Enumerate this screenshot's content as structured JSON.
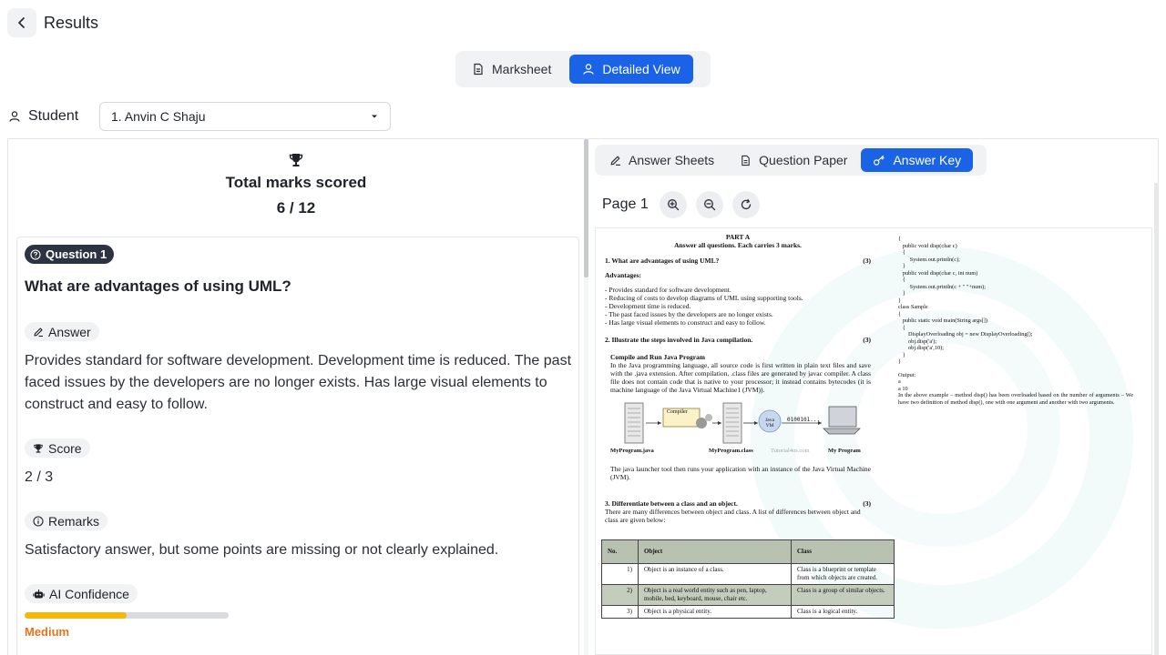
{
  "header": {
    "title": "Results"
  },
  "view_switch": {
    "items": [
      {
        "label": "Marksheet",
        "active": false
      },
      {
        "label": "Detailed View",
        "active": true
      }
    ]
  },
  "student": {
    "label": "Student",
    "selected": "1. Anvin C Shaju"
  },
  "summary": {
    "label": "Total marks scored",
    "value": "6 / 12"
  },
  "question": {
    "badge": "Question 1",
    "title": "What are advantages of using UML?",
    "answer_chip": "Answer",
    "answer_text": "Provides standard for software development. Development time is reduced. The past faced issues by the developers are no longer exists. Has large visual elements to construct and easy to follow.",
    "score_chip": "Score",
    "score_value": "2 / 3",
    "remarks_chip": "Remarks",
    "remarks_text": "Satisfactory answer, but some points are missing or not clearly explained.",
    "confidence_chip": "AI Confidence",
    "confidence_level": "Medium",
    "confidence_fraction": 0.5
  },
  "doc_tabs": [
    {
      "label": "Answer Sheets",
      "active": false
    },
    {
      "label": "Question Paper",
      "active": false
    },
    {
      "label": "Answer Key",
      "active": true
    }
  ],
  "viewer": {
    "page_label": "Page 1"
  },
  "doc": {
    "part": "PART A",
    "instructions": "Answer all questions. Each carries 3 marks.",
    "q1": {
      "text": "1.   What are advantages of using UML?",
      "marks": "(3)"
    },
    "advantages_head": "Advantages:",
    "advantages": [
      "- Provides standard for software development.",
      "- Reducing of costs to develop diagrams of UML using supporting tools.",
      "- Development time is reduced.",
      "- The past faced issues by the developers are no longer exists.",
      "- Has large visual elements to construct and easy to follow."
    ],
    "q2": {
      "text": "2. Illustrate the steps involved in Java compilation.",
      "marks": "(3)"
    },
    "compile_head": "Compile and Run Java Program",
    "compile_text": "In the Java programming language, all source code is first written in plain text files and save with the .java extension. After compilation, .class files are generated by javac compiler. A class file does not contain code that is native to your processor; it instead contains bytecodes (it is machine language of the Java Virtual Machine1 (JVM)).",
    "diagram": {
      "compiler": "Compiler",
      "jvm": "Java VM",
      "binary": "0100101...",
      "src": "MyProgram.java",
      "cls": "MyProgram.class",
      "site": "Tutorial4us.com",
      "prog": "My Program"
    },
    "launcher_text": "The java launcher tool then runs your application with an instance of the Java Virtual Machine (JVM).",
    "q3": {
      "text": "3. Differentiate between a class and an object.",
      "marks": "(3)"
    },
    "q3_intro": "There are many differences between object and class. A list of differences between object and class are given below:",
    "table": {
      "headers": [
        "No.",
        "Object",
        "Class"
      ],
      "rows": [
        [
          "1)",
          "Object is an instance of a class.",
          "Class is a blueprint or template from which objects are created."
        ],
        [
          "2)",
          "Object is a real world entity such as pen, laptop, mobile, bed, keyboard, mouse, chair etc.",
          "Class is a group of similar objects."
        ],
        [
          "3)",
          "Object is a physical entity.",
          "Class is a logical entity."
        ]
      ]
    },
    "code_lines": [
      "{",
      "   public void disp(char c)",
      "   {",
      "        System.out.println(c);",
      "   }",
      "   public void disp(char c, int num)",
      "   {",
      "        System.out.println(c + \" \"+num);",
      "   }",
      "}",
      "class Sample",
      "{",
      "   public static void main(String args[])",
      "   {",
      "       DisplayOverloading obj = new DisplayOverloading();",
      "       obj.disp('a');",
      "       obj.disp('a',10);",
      "   }",
      "}"
    ],
    "output_head": "Output:",
    "output_lines": [
      "a",
      "a 10"
    ],
    "explanation": "In the above example – method disp() has been overloaded based on the number of arguments – We have two definition of method disp(), one with one argument and another with two arguments."
  }
}
